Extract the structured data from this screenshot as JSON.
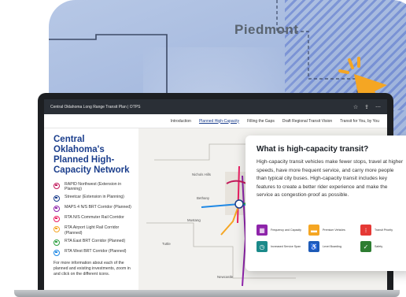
{
  "background": {
    "map_label": "Piedmont"
  },
  "app": {
    "window_title": "Central Oklahoma Long Range Transit Plan | OTPS"
  },
  "nav": {
    "items": [
      {
        "label": "Introduction"
      },
      {
        "label": "Planned High-Capacity"
      },
      {
        "label": "Filling the Gaps"
      },
      {
        "label": "Draft Regional Transit Vision"
      },
      {
        "label": "Transit for You, by You"
      }
    ]
  },
  "sidebar": {
    "title": "Central Oklahoma's Planned High-Capacity Network",
    "legend": [
      {
        "label": "RAPID Northwest (Extension in Planning)",
        "color": "#c2185b"
      },
      {
        "label": "Streetcar (Extension in Planning)",
        "color": "#1b3e8c"
      },
      {
        "label": "MAPS 4 N/S BRT Corridor (Planned)",
        "color": "#8e24aa"
      },
      {
        "label": "RTA N/S Commuter Rail Corridor",
        "color": "#e91e63"
      },
      {
        "label": "RTA Airport Light Rail Corridor (Planned)",
        "color": "#f5a623"
      },
      {
        "label": "RTA East BRT Corridor (Planned)",
        "color": "#2ea043"
      },
      {
        "label": "RTA West BRT Corridor (Planned)",
        "color": "#1e88e5"
      }
    ],
    "note": "For more information about each of the planned and existing investments, zoom in and click on the different icons."
  },
  "map": {
    "places": [
      {
        "label": "Nichols Hills"
      },
      {
        "label": "Bethany"
      },
      {
        "label": "OKLAHOMA"
      },
      {
        "label": "Midwest City"
      },
      {
        "label": "Mustang"
      },
      {
        "label": "Moore"
      },
      {
        "label": "Tuttle"
      },
      {
        "label": "CLEVELAND"
      },
      {
        "label": "Newcastle"
      }
    ]
  },
  "popup": {
    "title": "What is high-capacity transit?",
    "body": "High-capacity transit vehicles make fewer stops, travel at higher speeds, have more frequent service, and carry more people than typical city buses. High-capacity transit includes key features to create a better rider experience and make the service as congestion-proof as possible.",
    "features": [
      {
        "label": "Frequency and Capacity",
        "icon": "bus-group-icon",
        "color": "#8e24aa"
      },
      {
        "label": "Premium Vehicles",
        "icon": "vehicle-icon",
        "color": "#f5a623"
      },
      {
        "label": "Transit Priority",
        "icon": "signal-icon",
        "color": "#e53935"
      },
      {
        "label": "Increased Service Span",
        "icon": "clock-icon",
        "color": "#1b8a8a"
      },
      {
        "label": "Level Boarding",
        "icon": "accessible-icon",
        "color": "#1e5bb8"
      },
      {
        "label": "Safety",
        "icon": "shield-check-icon",
        "color": "#2e7d32"
      }
    ]
  }
}
